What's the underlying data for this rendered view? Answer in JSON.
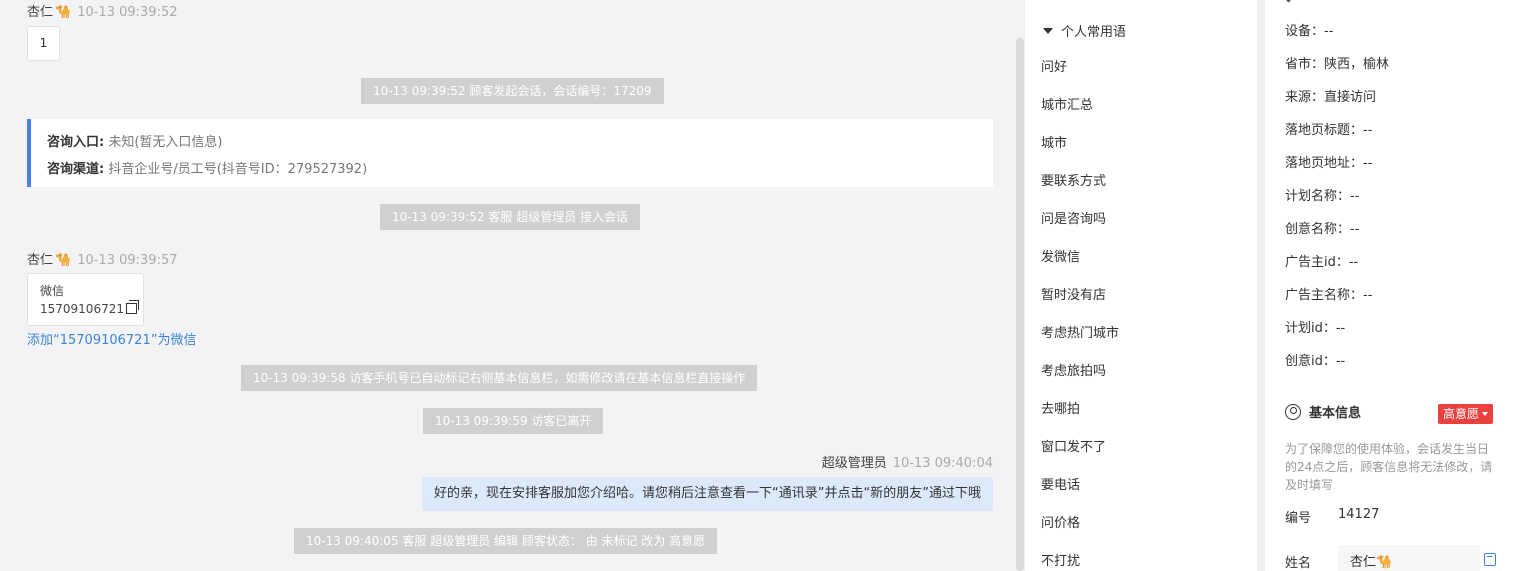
{
  "chat": {
    "sender_1": {
      "name": "杏仁",
      "emoji": "🐪",
      "time": "10-13 09:39:52"
    },
    "bubble_1": "1",
    "sys_1": "10-13 09:39:52 顾客发起会话，会话编号：17209",
    "entry_card": {
      "entry_label": "咨询入口:",
      "entry_value": "未知(暂无入口信息)",
      "channel_label": "咨询渠道:",
      "channel_value": "抖音企业号/员工号(抖音号ID：279527392)"
    },
    "sys_2": "10-13 09:39:52 客服 超级管理员 接入会话",
    "sender_2": {
      "name": "杏仁",
      "emoji": "🐪",
      "time": "10-13 09:39:57"
    },
    "wechat_card": {
      "title": "微信",
      "number": "15709106721"
    },
    "add_wechat_link": "添加“15709106721”为微信",
    "sys_3": "10-13 09:39:58 访客手机号已自动标记右侧基本信息栏，如需修改请在基本信息栏直接操作",
    "sys_4": "10-13 09:39:59 访客已离开",
    "agent": {
      "name": "超级管理员",
      "time": "10-13 09:40:04"
    },
    "agent_msg": "好的亲，现在安排客服加您介绍哈。请您稍后注意查看一下“通讯录”并点击“新的朋友”通过下哦",
    "sys_5": "10-13 09:40:05 客服 超级管理员 编辑 顾客状态： 由 未标记 改为 高意愿"
  },
  "phrases": {
    "header": "个人常用语",
    "items": [
      "问好",
      "城市汇总",
      "城市",
      "要联系方式",
      "问是咨询吗",
      "发微信",
      "暂时没有店",
      "考虑热门城市",
      "考虑旅拍吗",
      "去哪拍",
      "窗口发不了",
      "要电话",
      "问价格",
      "不打扰"
    ]
  },
  "info": {
    "rows": [
      "设备：--",
      "省市：陕西，榆林",
      "来源：直接访问",
      "落地页标题：--",
      "落地页地址：--",
      "计划名称：--",
      "创意名称：--",
      "广告主id：--",
      "广告主名称：--",
      "计划id：--",
      "创意id：--"
    ],
    "basic_title": "基本信息",
    "intent_badge": "高意愿",
    "intent_color": "#e8423e",
    "notice": "为了保障您的使用体验，会话发生当日的24点之后，顾客信息将无法修改，请及时填写",
    "number_label": "编号",
    "number_value": "14127",
    "name_label": "姓名",
    "name_value": "杏仁🐪"
  },
  "colors": {
    "link": "#3b84d8",
    "entry_accent": "#4a7fe8",
    "agent_bubble": "#dce9fb",
    "system_bubble": "#d0d0d3"
  }
}
